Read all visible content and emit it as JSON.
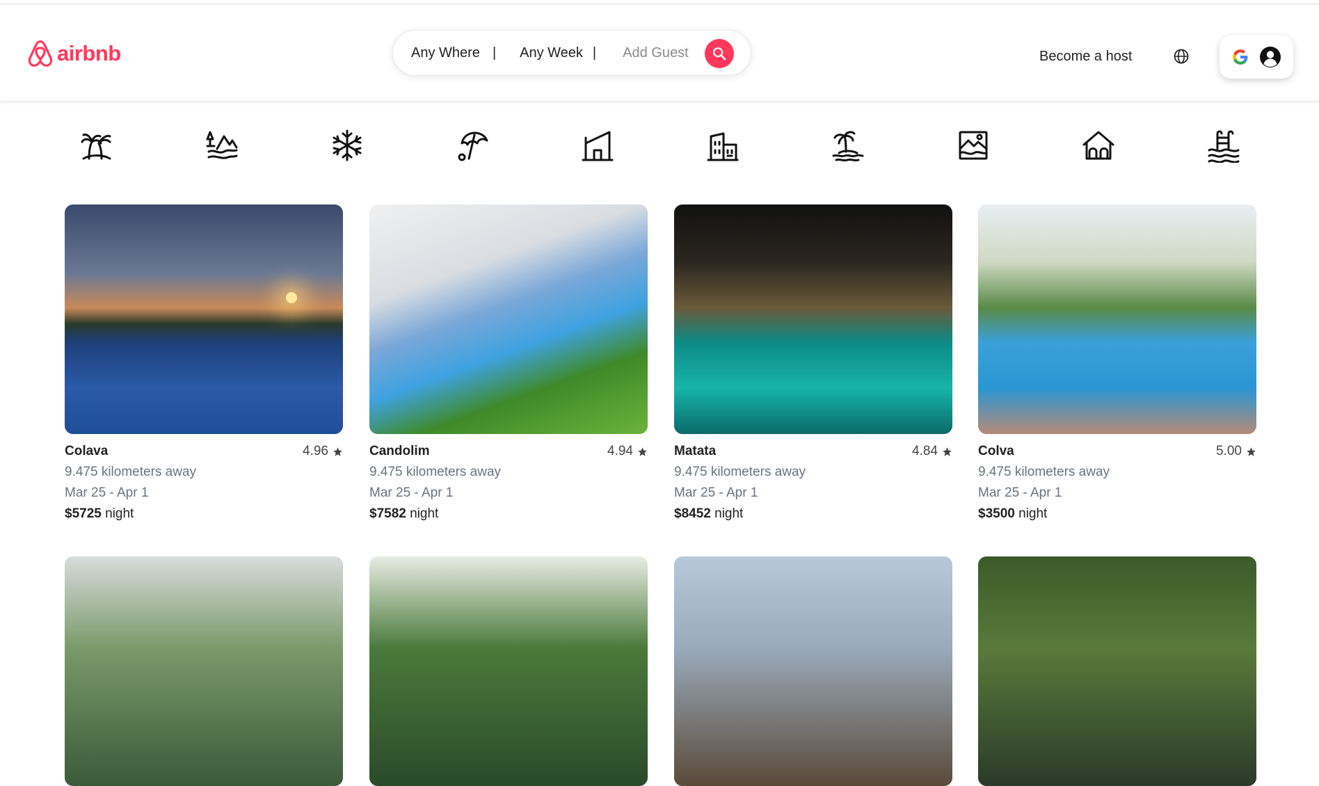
{
  "header": {
    "logo_text": "airbnb",
    "search": {
      "where": "Any Where",
      "week": "Any Week",
      "separator": "|",
      "guest": "Add Guest"
    },
    "become_host": "Become a host"
  },
  "categories": [
    {
      "icon": "palm-trees-icon"
    },
    {
      "icon": "countryside-icon"
    },
    {
      "icon": "snowflake-icon"
    },
    {
      "icon": "beach-umbrella-icon"
    },
    {
      "icon": "modern-house-icon"
    },
    {
      "icon": "buildings-icon"
    },
    {
      "icon": "island-icon"
    },
    {
      "icon": "lake-view-icon"
    },
    {
      "icon": "cabins-icon"
    },
    {
      "icon": "pools-icon"
    }
  ],
  "listings": [
    {
      "title": "Colava",
      "rating": "4.96",
      "distance": "9.475 kilometers away",
      "dates": "Mar 25 - Apr 1",
      "price": "$5725",
      "price_unit": "night"
    },
    {
      "title": "Candolim",
      "rating": "4.94",
      "distance": "9.475 kilometers away",
      "dates": "Mar 25 - Apr 1",
      "price": "$7582",
      "price_unit": "night"
    },
    {
      "title": "Matata",
      "rating": "4.84",
      "distance": "9.475 kilometers away",
      "dates": "Mar 25 - Apr 1",
      "price": "$8452",
      "price_unit": "night"
    },
    {
      "title": "Colva",
      "rating": "5.00",
      "distance": "9.475 kilometers away",
      "dates": "Mar 25 - Apr 1",
      "price": "$3500",
      "price_unit": "night"
    }
  ],
  "colors": {
    "brand": "#FF385C",
    "text": "#222222",
    "muted": "#6b7280"
  }
}
